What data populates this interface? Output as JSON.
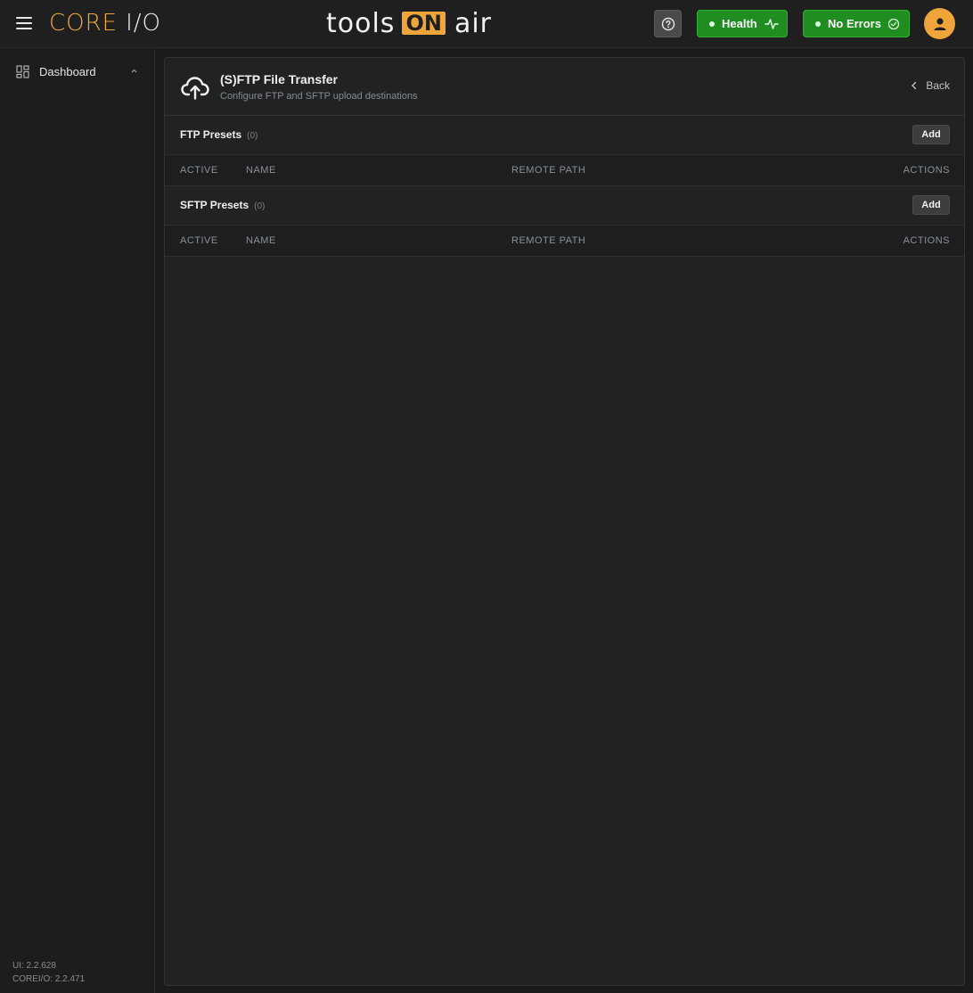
{
  "brand": {
    "core": "CORE",
    "io": "I/O"
  },
  "center_logo": {
    "tools": "tools",
    "on": "ON",
    "air": "air"
  },
  "header": {
    "health_label": "Health",
    "errors_label": "No Errors",
    "status_color": "#1f8d1f",
    "accent_color": "#f0a53a"
  },
  "sidebar": {
    "items": [
      {
        "label": "Dashboard",
        "icon": "dashboard-icon"
      }
    ]
  },
  "versions": {
    "ui": "UI: 2.2.628",
    "core": "COREI/O: 2.2.471"
  },
  "page": {
    "title": "(S)FTP File Transfer",
    "subtitle": "Configure FTP and SFTP upload destinations",
    "back_label": "Back"
  },
  "sections": [
    {
      "title": "FTP Presets",
      "count": "(0)",
      "add_label": "Add"
    },
    {
      "title": "SFTP Presets",
      "count": "(0)",
      "add_label": "Add"
    }
  ],
  "table_columns": {
    "active": "ACTIVE",
    "name": "NAME",
    "remote_path": "REMOTE PATH",
    "actions": "ACTIONS"
  }
}
